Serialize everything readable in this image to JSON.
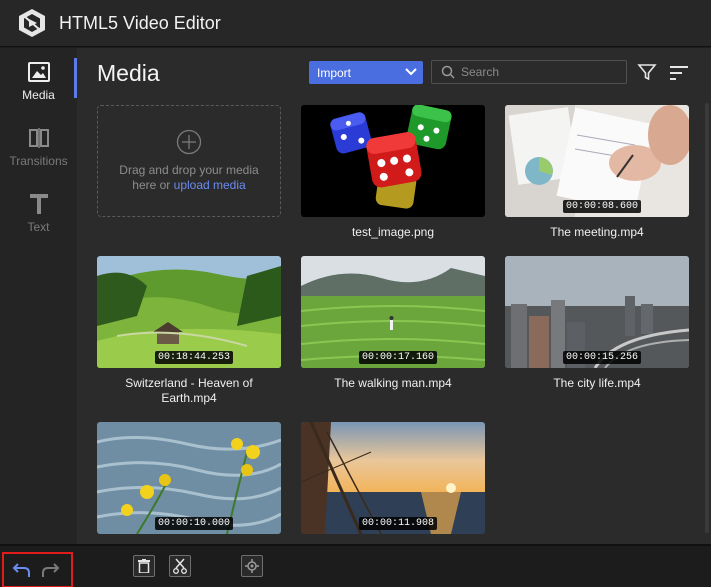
{
  "app": {
    "title": "HTML5 Video Editor"
  },
  "sidebar": {
    "items": [
      {
        "label": "Media",
        "icon": "image-icon",
        "active": true
      },
      {
        "label": "Transitions",
        "icon": "transitions-icon",
        "active": false
      },
      {
        "label": "Text",
        "icon": "text-icon",
        "active": false
      }
    ]
  },
  "main": {
    "title": "Media",
    "import_label": "Import",
    "search_placeholder": "Search",
    "dropzone": {
      "line1": "Drag and drop your media",
      "line2_prefix": "here or ",
      "link": "upload media"
    },
    "media": [
      {
        "name": "test_image.png",
        "duration": ""
      },
      {
        "name": "The meeting.mp4",
        "duration": "00:00:08.600"
      },
      {
        "name": "Switzerland - Heaven of Earth.mp4",
        "duration": "00:18:44.253"
      },
      {
        "name": "The walking man.mp4",
        "duration": "00:00:17.160"
      },
      {
        "name": "The city life.mp4",
        "duration": "00:00:15.256"
      },
      {
        "name": "",
        "duration": "00:00:10.000"
      },
      {
        "name": "",
        "duration": "00:00:11.908"
      }
    ]
  },
  "colors": {
    "accent": "#4a6ee0",
    "highlight_box": "#e21b1b",
    "background": "#2b2b2b"
  }
}
